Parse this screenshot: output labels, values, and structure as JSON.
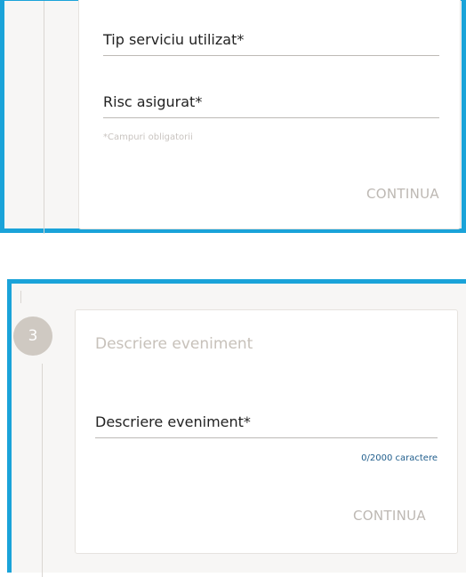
{
  "step2": {
    "service_type_label": "Tip serviciu utilizat*",
    "insured_risk_label": "Risc asigurat*",
    "required_note": "*Campuri obligatorii",
    "continue_label": "CONTINUA"
  },
  "step3": {
    "number": "3",
    "title": "Descriere eveniment",
    "description_label": "Descriere eveniment*",
    "char_counter": "0/2000 caractere",
    "continue_label": "CONTINUA"
  },
  "colors": {
    "accent_border": "#1aa3d9",
    "step_circle": "#cfc9c2",
    "counter_text": "#1f5d8c"
  }
}
